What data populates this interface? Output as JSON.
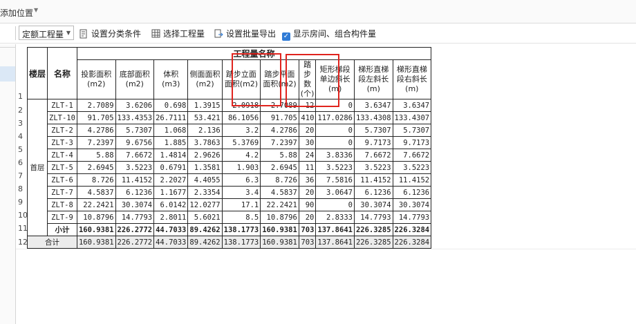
{
  "topbar": {
    "title": "添加位置"
  },
  "toolbar": {
    "quota_select": "定额工程量",
    "set_classification": "设置分类条件",
    "select_quantity": "选择工程量",
    "batch_export": "设置批量导出",
    "show_rooms": "显示房间、组合构件量"
  },
  "report": {
    "group_header": "工程量名称",
    "col_floor": "楼层",
    "col_name": "名称",
    "columns": [
      "投影面积(m2)",
      "底部面积(m2)",
      "体积(m3)",
      "侧面面积(m2)",
      "踏步立面面积(m2)",
      "踏步平面面积(m2)",
      "踏步数(个)",
      "矩形梯段单边斜长(m)",
      "梯形直梯段左斜长(m)",
      "梯形直梯段右斜长(m)"
    ],
    "floor": "首层",
    "rows": [
      {
        "num": "1",
        "name": "ZLT-1",
        "values": [
          "2.7089",
          "3.6206",
          "0.698",
          "1.3915",
          "2.0918",
          "2.7089",
          "12",
          "0",
          "3.6347",
          "3.6347"
        ]
      },
      {
        "num": "2",
        "name": "ZLT-10",
        "values": [
          "91.705",
          "133.4353",
          "26.7111",
          "53.421",
          "86.1056",
          "91.705",
          "410",
          "117.0286",
          "133.4308",
          "133.4307"
        ]
      },
      {
        "num": "3",
        "name": "ZLT-2",
        "values": [
          "4.2786",
          "5.7307",
          "1.068",
          "2.136",
          "3.2",
          "4.2786",
          "20",
          "0",
          "5.7307",
          "5.7307"
        ]
      },
      {
        "num": "4",
        "name": "ZLT-3",
        "values": [
          "7.2397",
          "9.6756",
          "1.885",
          "3.7863",
          "5.3769",
          "7.2397",
          "30",
          "0",
          "9.7173",
          "9.7173"
        ]
      },
      {
        "num": "5",
        "name": "ZLT-4",
        "values": [
          "5.88",
          "7.6672",
          "1.4814",
          "2.9626",
          "4.2",
          "5.88",
          "24",
          "3.8336",
          "7.6672",
          "7.6672"
        ]
      },
      {
        "num": "6",
        "name": "ZLT-5",
        "values": [
          "2.6945",
          "3.5223",
          "0.6791",
          "1.3581",
          "1.903",
          "2.6945",
          "11",
          "3.5223",
          "3.5223",
          "3.5223"
        ]
      },
      {
        "num": "7",
        "name": "ZLT-6",
        "values": [
          "8.726",
          "11.4152",
          "2.2027",
          "4.4055",
          "6.3",
          "8.726",
          "36",
          "7.5816",
          "11.4152",
          "11.4152"
        ]
      },
      {
        "num": "8",
        "name": "ZLT-7",
        "values": [
          "4.5837",
          "6.1236",
          "1.1677",
          "2.3354",
          "3.4",
          "4.5837",
          "20",
          "3.0647",
          "6.1236",
          "6.1236"
        ]
      },
      {
        "num": "9",
        "name": "ZLT-8",
        "values": [
          "22.2421",
          "30.3074",
          "6.0142",
          "12.0277",
          "17.1",
          "22.2421",
          "90",
          "0",
          "30.3074",
          "30.3074"
        ]
      },
      {
        "num": "10",
        "name": "ZLT-9",
        "values": [
          "10.8796",
          "14.7793",
          "2.8011",
          "5.6021",
          "8.5",
          "10.8796",
          "20",
          "2.8333",
          "14.7793",
          "14.7793"
        ]
      }
    ],
    "subtotal": {
      "num": "11",
      "label": "小计",
      "values": [
        "160.9381",
        "226.2772",
        "44.7033",
        "89.4262",
        "138.1773",
        "160.9381",
        "703",
        "137.8641",
        "226.3285",
        "226.3284"
      ]
    },
    "total": {
      "num": "12",
      "label": "合计",
      "values": [
        "160.9381",
        "226.2772",
        "44.7033",
        "89.4262",
        "138.1773",
        "160.9381",
        "703",
        "137.8641",
        "226.3285",
        "226.3284"
      ]
    }
  },
  "highlight_color": "#e0231d"
}
